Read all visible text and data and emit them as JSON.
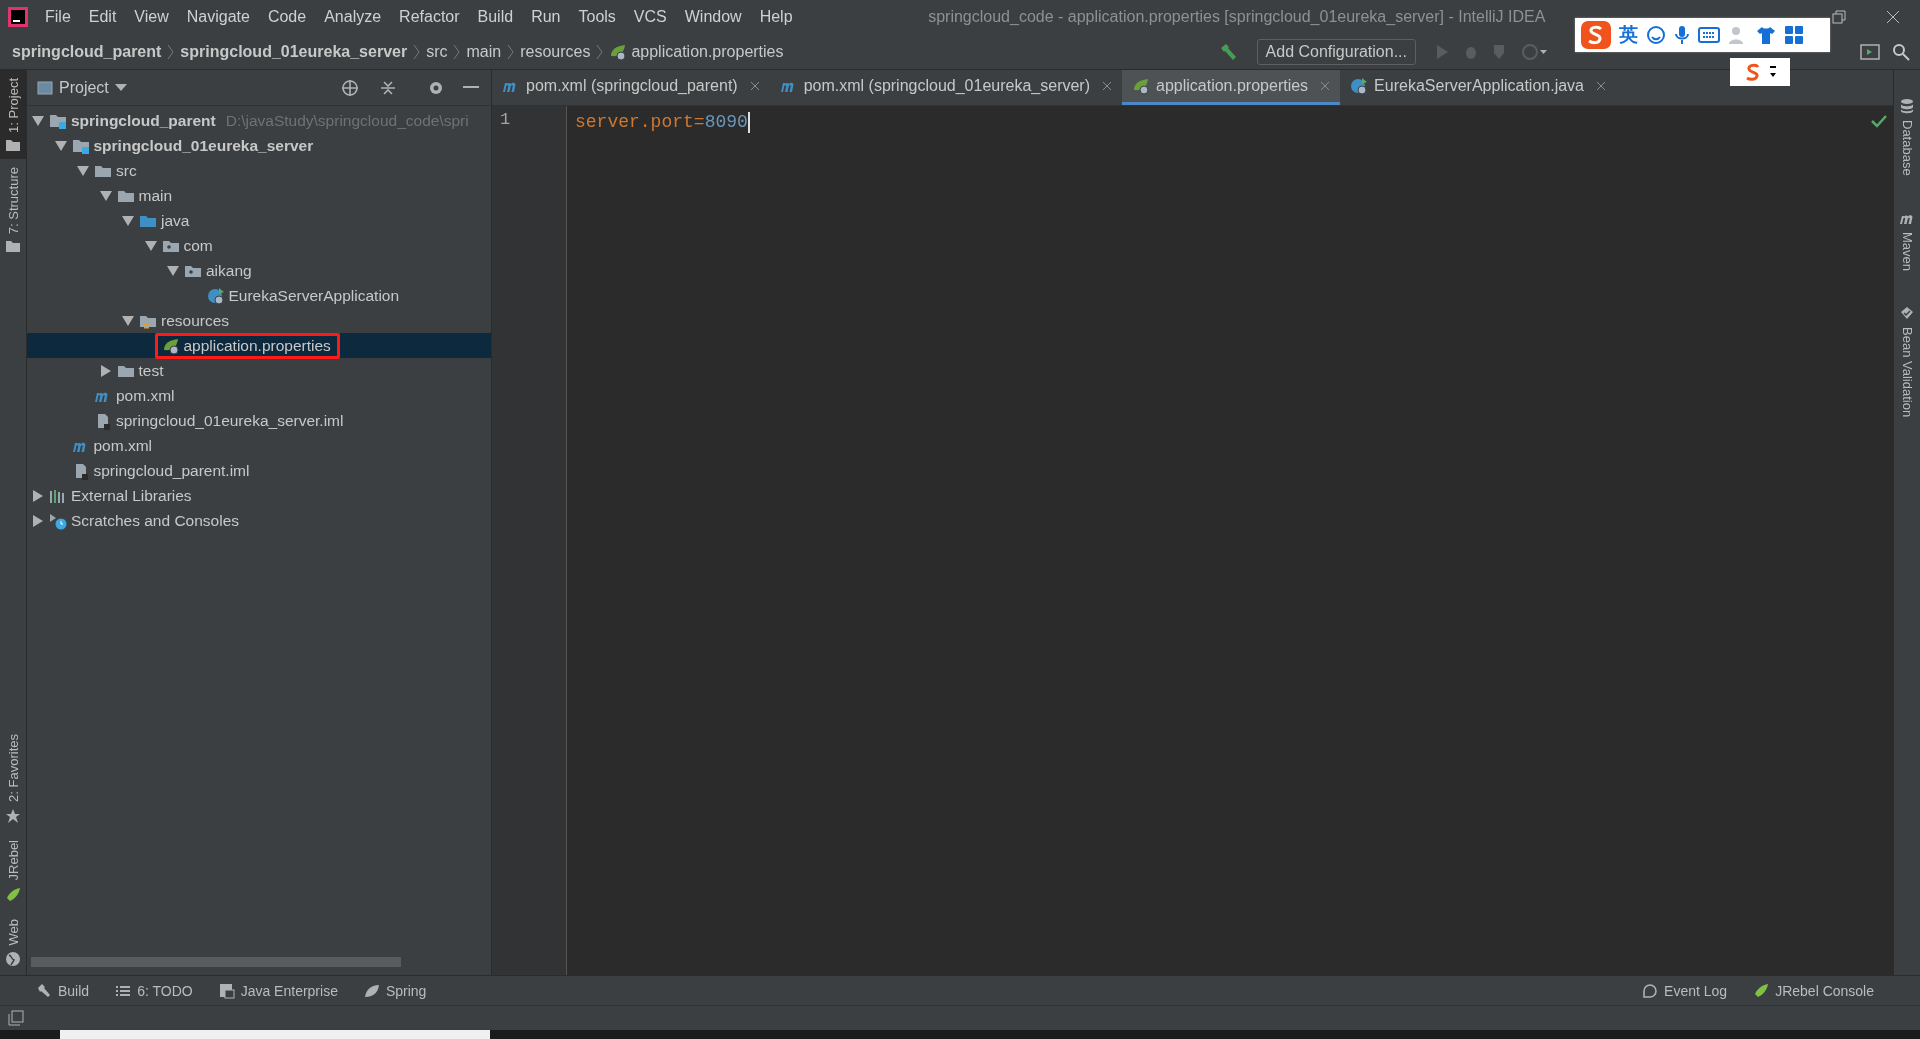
{
  "window": {
    "title": "springcloud_code - application.properties [springcloud_01eureka_server] - IntelliJ IDEA",
    "menu": [
      "File",
      "Edit",
      "View",
      "Navigate",
      "Code",
      "Analyze",
      "Refactor",
      "Build",
      "Run",
      "Tools",
      "VCS",
      "Window",
      "Help"
    ]
  },
  "breadcrumbs": [
    {
      "label": "springcloud_parent",
      "bold": true
    },
    {
      "label": "springcloud_01eureka_server",
      "bold": true
    },
    {
      "label": "src",
      "bold": false
    },
    {
      "label": "main",
      "bold": false
    },
    {
      "label": "resources",
      "bold": false
    },
    {
      "label": "application.properties",
      "bold": false
    }
  ],
  "toolbar": {
    "run_config": "Add Configuration..."
  },
  "ime_bar": {
    "mode": "英"
  },
  "left_stripe": {
    "top": [
      {
        "label": "1: Project",
        "selected": true
      },
      {
        "label": "7: Structure",
        "selected": false
      }
    ],
    "bottom": [
      {
        "label": "2: Favorites"
      },
      {
        "label": "JRebel"
      },
      {
        "label": "Web"
      }
    ]
  },
  "project_panel": {
    "title": "Project",
    "tree": [
      {
        "label": "springcloud_parent",
        "hint": "D:\\javaStudy\\springcloud_code\\spri",
        "kind": "module",
        "bold": true,
        "expanded": true,
        "selected": false,
        "marked": false,
        "children": [
          {
            "label": "springcloud_01eureka_server",
            "kind": "module",
            "bold": true,
            "expanded": true,
            "selected": false,
            "marked": false,
            "children": [
              {
                "label": "src",
                "kind": "folder",
                "bold": false,
                "expanded": true,
                "selected": false,
                "marked": false,
                "children": [
                  {
                    "label": "main",
                    "kind": "folder",
                    "bold": false,
                    "expanded": true,
                    "selected": false,
                    "marked": false,
                    "children": [
                      {
                        "label": "java",
                        "kind": "source",
                        "bold": false,
                        "expanded": true,
                        "selected": false,
                        "marked": false,
                        "children": [
                          {
                            "label": "com",
                            "kind": "package",
                            "bold": false,
                            "expanded": true,
                            "selected": false,
                            "marked": false,
                            "children": [
                              {
                                "label": "aikang",
                                "kind": "package",
                                "bold": false,
                                "expanded": true,
                                "selected": false,
                                "marked": false,
                                "children": [
                                  {
                                    "label": "EurekaServerApplication",
                                    "kind": "class",
                                    "bold": false,
                                    "selected": false,
                                    "marked": false
                                  }
                                ]
                              }
                            ]
                          }
                        ]
                      },
                      {
                        "label": "resources",
                        "kind": "resources",
                        "bold": false,
                        "expanded": true,
                        "selected": false,
                        "marked": false,
                        "children": [
                          {
                            "label": "application.properties",
                            "kind": "properties",
                            "bold": false,
                            "selected": true,
                            "marked": true
                          }
                        ]
                      }
                    ]
                  },
                  {
                    "label": "test",
                    "kind": "folder",
                    "bold": false,
                    "expanded": false,
                    "selected": false,
                    "marked": false
                  }
                ]
              },
              {
                "label": "pom.xml",
                "kind": "maven",
                "bold": false,
                "selected": false,
                "marked": false
              },
              {
                "label": "springcloud_01eureka_server.iml",
                "kind": "iml",
                "bold": false,
                "selected": false,
                "marked": false
              }
            ]
          },
          {
            "label": "pom.xml",
            "kind": "maven",
            "bold": false,
            "selected": false,
            "marked": false
          },
          {
            "label": "springcloud_parent.iml",
            "kind": "iml",
            "bold": false,
            "selected": false,
            "marked": false
          }
        ]
      },
      {
        "label": "External Libraries",
        "kind": "libraries",
        "bold": false,
        "expanded": false,
        "selected": false,
        "marked": false
      },
      {
        "label": "Scratches and Consoles",
        "kind": "scratches",
        "bold": false,
        "expanded": false,
        "selected": false,
        "marked": false
      }
    ]
  },
  "editor_tabs": [
    {
      "label": "pom.xml (springcloud_parent)",
      "kind": "maven",
      "selected": false
    },
    {
      "label": "pom.xml (springcloud_01eureka_server)",
      "kind": "maven",
      "selected": false
    },
    {
      "label": "application.properties",
      "kind": "properties",
      "selected": true
    },
    {
      "label": "EurekaServerApplication.java",
      "kind": "class",
      "selected": false
    }
  ],
  "editor": {
    "lines": [
      {
        "number": "1",
        "key": "server.port=",
        "value": "8090"
      }
    ]
  },
  "right_stripe": [
    {
      "label": "Database"
    },
    {
      "label": "Maven"
    },
    {
      "label": "Bean Validation"
    }
  ],
  "tool_windows": {
    "left": [
      {
        "label": "Build"
      },
      {
        "label": "6: TODO"
      },
      {
        "label": "Java Enterprise"
      },
      {
        "label": "Spring"
      }
    ],
    "right": [
      {
        "label": "Event Log"
      },
      {
        "label": "JRebel Console"
      }
    ]
  }
}
